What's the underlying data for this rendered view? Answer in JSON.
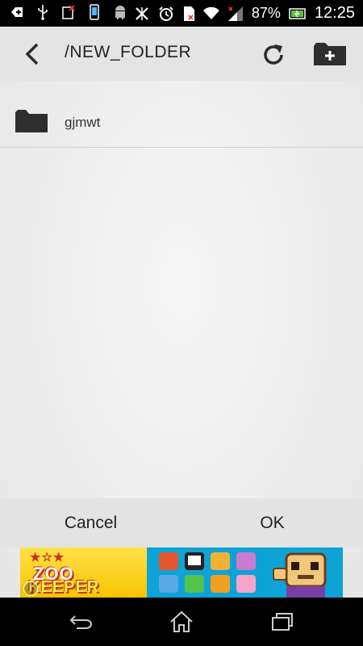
{
  "status_bar": {
    "battery_percent": "87%",
    "time": "12:25",
    "left_icons": [
      "add-icon",
      "usb-icon",
      "debug-icon",
      "phone-icon",
      "android-icon"
    ],
    "right_icons": [
      "no-signal-icon",
      "alarm-icon",
      "sd-card-icon",
      "wifi-icon",
      "signal-icon",
      "battery-icon"
    ]
  },
  "toolbar": {
    "path": "/NEW_FOLDER",
    "back_icon": "chevron-left-icon",
    "refresh_icon": "refresh-icon",
    "new_folder_icon": "folder-plus-icon"
  },
  "files": [
    {
      "name": "gjmwt",
      "icon": "folder-icon"
    }
  ],
  "buttons": {
    "cancel": "Cancel",
    "ok": "OK"
  },
  "ad": {
    "line1": "ZOO",
    "line2": "KEEPER",
    "info": "i"
  },
  "colors": {
    "toolbar_bg": "#e4e4e4",
    "button_bar_bg": "#e3e3e3",
    "ad_blue": "#0ea3d6",
    "ad_yellow": "#ffe24a"
  }
}
